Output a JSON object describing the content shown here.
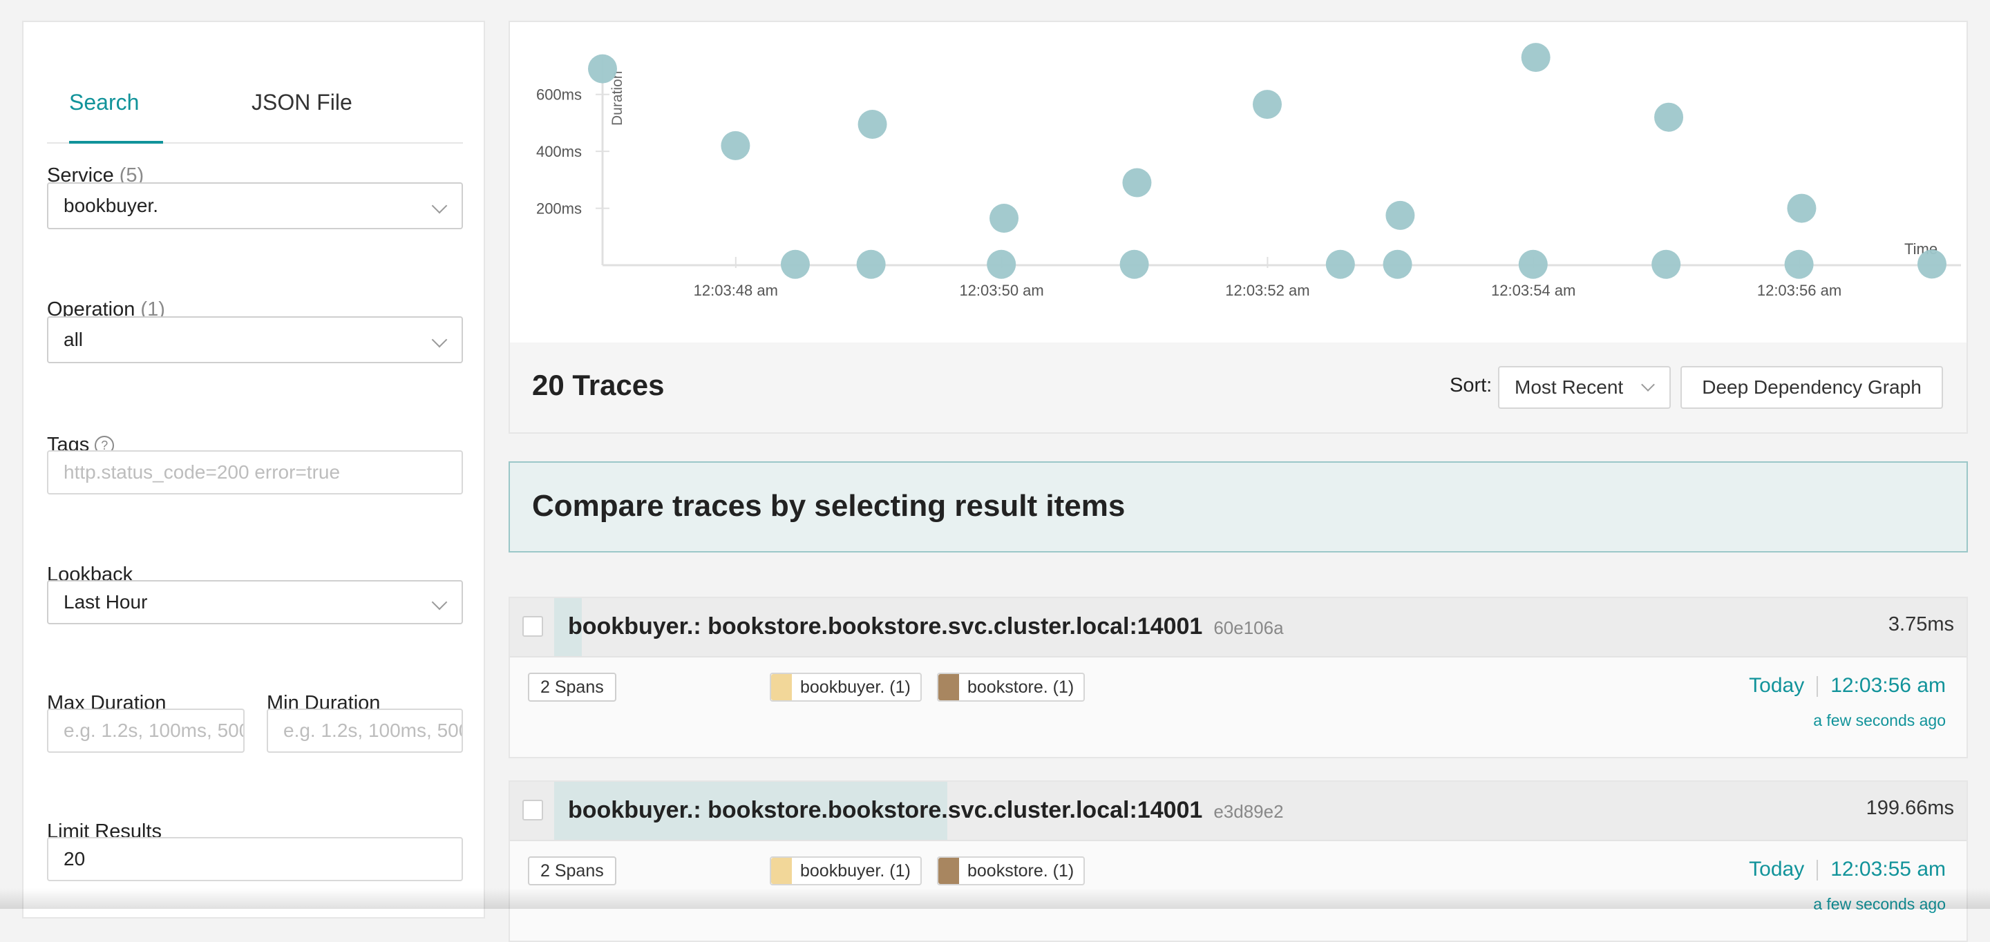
{
  "search_panel": {
    "tabs": [
      {
        "label": "Search",
        "active": true
      },
      {
        "label": "JSON File",
        "active": false
      }
    ],
    "service": {
      "label": "Service",
      "count": "(5)",
      "value": "bookbuyer."
    },
    "operation": {
      "label": "Operation",
      "count": "(1)",
      "value": "all"
    },
    "tags": {
      "label": "Tags",
      "help_glyph": "?",
      "placeholder": "http.status_code=200 error=true"
    },
    "lookback": {
      "label": "Lookback",
      "value": "Last Hour"
    },
    "max_duration": {
      "label": "Max Duration",
      "placeholder": "e.g. 1.2s, 100ms, 500us"
    },
    "min_duration": {
      "label": "Min Duration",
      "placeholder": "e.g. 1.2s, 100ms, 500us"
    },
    "limit_results": {
      "label": "Limit Results",
      "value": "20"
    }
  },
  "chart_data": {
    "type": "scatter",
    "xlabel": "Time",
    "ylabel": "Duration",
    "y_ticks": [
      "200ms",
      "400ms",
      "600ms"
    ],
    "x_ticks": [
      "12:03:48 am",
      "12:03:50 am",
      "12:03:52 am",
      "12:03:54 am",
      "12:03:56 am"
    ],
    "x_unit": "seconds after 12:03:46 am",
    "ylim_ms": [
      0,
      750
    ],
    "xlim_s": [
      0,
      10
    ],
    "marker_color": "#9ec7cb",
    "points": [
      {
        "x": 0.0,
        "y": 690
      },
      {
        "x": 1.0,
        "y": 420
      },
      {
        "x": 1.45,
        "y": 3
      },
      {
        "x": 2.02,
        "y": 3
      },
      {
        "x": 2.03,
        "y": 495
      },
      {
        "x": 3.0,
        "y": 3
      },
      {
        "x": 3.02,
        "y": 165
      },
      {
        "x": 4.0,
        "y": 3
      },
      {
        "x": 4.02,
        "y": 290
      },
      {
        "x": 5.0,
        "y": 565
      },
      {
        "x": 5.55,
        "y": 3
      },
      {
        "x": 5.98,
        "y": 3
      },
      {
        "x": 6.0,
        "y": 175
      },
      {
        "x": 7.0,
        "y": 3
      },
      {
        "x": 7.02,
        "y": 730
      },
      {
        "x": 8.0,
        "y": 3
      },
      {
        "x": 8.02,
        "y": 520
      },
      {
        "x": 9.0,
        "y": 3
      },
      {
        "x": 9.02,
        "y": 200
      },
      {
        "x": 10.0,
        "y": 4
      }
    ]
  },
  "results_header": {
    "traces_count": "20 Traces",
    "sort_label": "Sort:",
    "sort_value": "Most Recent",
    "ddg_button": "Deep Dependency Graph"
  },
  "compare_banner": "Compare traces by selecting result items",
  "traces": [
    {
      "title": "bookbuyer.: bookstore.bookstore.svc.cluster.local:14001",
      "trace_id": "60e106a",
      "duration": "3.75ms",
      "duration_fraction": 0.019,
      "spans": "2 Spans",
      "services": [
        {
          "name": "bookbuyer. (1)",
          "color": "#f2d799"
        },
        {
          "name": "bookstore. (1)",
          "color": "#a88660"
        }
      ],
      "date": "Today",
      "time": "12:03:56 am",
      "ago": "a few seconds ago"
    },
    {
      "title": "bookbuyer.: bookstore.bookstore.svc.cluster.local:14001",
      "trace_id": "e3d89e2",
      "duration": "199.66ms",
      "duration_fraction": 0.27,
      "spans": "2 Spans",
      "services": [
        {
          "name": "bookbuyer. (1)",
          "color": "#f2d799"
        },
        {
          "name": "bookstore. (1)",
          "color": "#a88660"
        }
      ],
      "date": "Today",
      "time": "12:03:55 am",
      "ago": "a few seconds ago"
    }
  ],
  "colors": {
    "accent": "#11939a",
    "scatter": "#9ec7cb",
    "banner_bg": "#e8f1f1"
  }
}
